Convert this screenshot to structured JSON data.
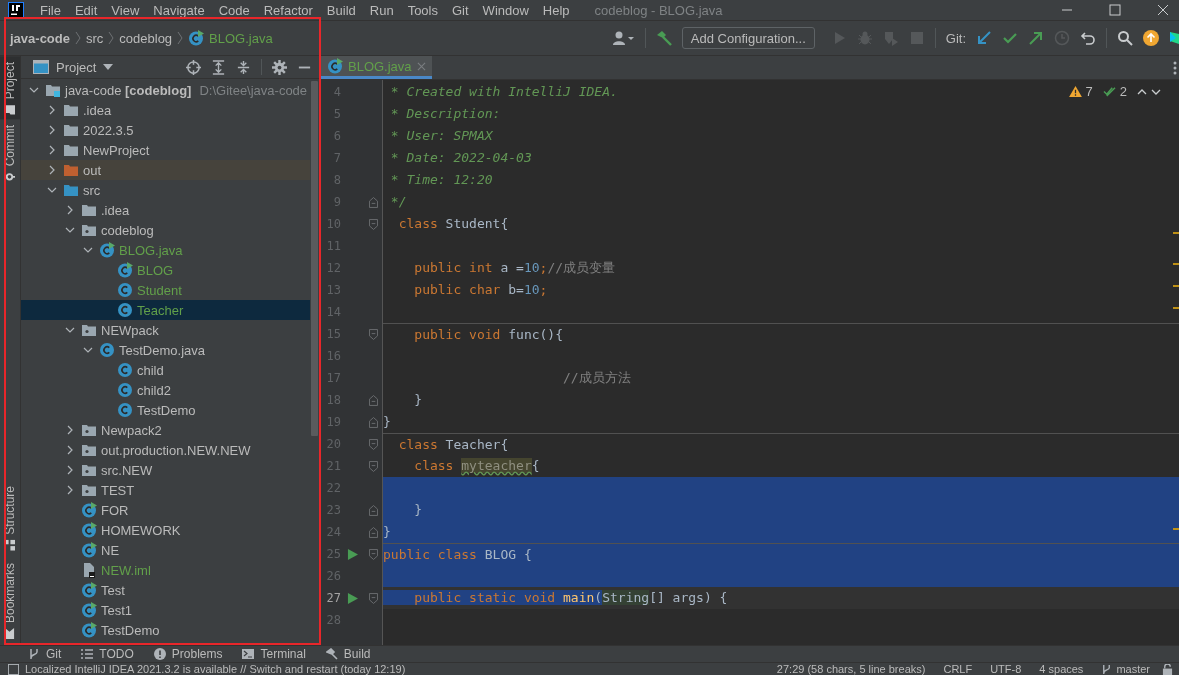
{
  "window": {
    "title": "codeblog - BLOG.java"
  },
  "menu": [
    "File",
    "Edit",
    "View",
    "Navigate",
    "Code",
    "Refactor",
    "Build",
    "Run",
    "Tools",
    "Git",
    "Window",
    "Help"
  ],
  "breadcrumbs": [
    "java-code",
    "src",
    "codeblog",
    "BLOG.java"
  ],
  "toolbar": {
    "config_button": "Add Configuration...",
    "git_label": "Git:",
    "actions": [
      {
        "kind": "run",
        "disabled": true
      },
      {
        "kind": "debug",
        "disabled": true
      },
      {
        "kind": "coverage",
        "disabled": true
      },
      {
        "kind": "stop",
        "disabled": true
      }
    ],
    "git_actions": [
      {
        "kind": "update",
        "disabled": false
      },
      {
        "kind": "commit",
        "disabled": false
      },
      {
        "kind": "push",
        "disabled": false
      },
      {
        "kind": "history",
        "disabled": true
      },
      {
        "kind": "rollback",
        "disabled": false
      }
    ]
  },
  "side_tabs": [
    {
      "label": "Project",
      "selected": true
    },
    {
      "label": "Commit",
      "selected": false
    },
    {
      "label": "Structure",
      "selected": false
    },
    {
      "label": "Bookmarks",
      "selected": false
    }
  ],
  "project": {
    "title": "Project",
    "tree": [
      {
        "label": "java-code **[codeblog]**",
        "path": "D:\\Gitee\\java-code",
        "kind": "module",
        "added": false,
        "selected": false,
        "expanded": true,
        "children": [
          {
            "label": ".idea",
            "kind": "folder",
            "added": false,
            "selected": false,
            "expanded": false
          },
          {
            "label": "2022.3.5",
            "kind": "folder",
            "added": false,
            "selected": false,
            "expanded": false
          },
          {
            "label": "NewProject",
            "kind": "folder",
            "added": false,
            "selected": false,
            "expanded": false
          },
          {
            "label": "out",
            "kind": "excluded-folder",
            "added": false,
            "selected": false,
            "expanded": false
          },
          {
            "label": "src",
            "kind": "source-folder",
            "added": false,
            "selected": false,
            "expanded": true,
            "children": [
              {
                "label": ".idea",
                "kind": "folder",
                "added": false,
                "selected": false,
                "expanded": false
              },
              {
                "label": "codeblog",
                "kind": "package",
                "added": false,
                "selected": false,
                "expanded": true,
                "children": [
                  {
                    "label": "BLOG.java",
                    "kind": "runnable-java-file",
                    "added": true,
                    "selected": false,
                    "expanded": true,
                    "children": [
                      {
                        "label": "BLOG",
                        "kind": "runnable-class",
                        "added": true,
                        "selected": false
                      },
                      {
                        "label": "Student",
                        "kind": "class",
                        "added": true,
                        "selected": false
                      },
                      {
                        "label": "Teacher",
                        "kind": "class",
                        "added": true,
                        "selected": true
                      }
                    ]
                  }
                ]
              },
              {
                "label": "NEWpack",
                "kind": "package",
                "added": false,
                "selected": false,
                "expanded": true,
                "children": [
                  {
                    "label": "TestDemo.java",
                    "kind": "java-file",
                    "added": false,
                    "selected": false,
                    "expanded": true,
                    "children": [
                      {
                        "label": "child",
                        "kind": "class",
                        "added": false,
                        "selected": false
                      },
                      {
                        "label": "child2",
                        "kind": "class",
                        "added": false,
                        "selected": false
                      },
                      {
                        "label": "TestDemo",
                        "kind": "class",
                        "added": false,
                        "selected": false
                      }
                    ]
                  }
                ]
              },
              {
                "label": "Newpack2",
                "kind": "package",
                "added": false,
                "selected": false,
                "expanded": false
              },
              {
                "label": "out.production.NEW.NEW",
                "kind": "package",
                "added": false,
                "selected": false,
                "expanded": false
              },
              {
                "label": "src.NEW",
                "kind": "package",
                "added": false,
                "selected": false,
                "expanded": false
              },
              {
                "label": "TEST",
                "kind": "package",
                "added": false,
                "selected": false,
                "expanded": false
              },
              {
                "label": "FOR",
                "kind": "runnable-class",
                "added": false,
                "selected": false
              },
              {
                "label": "HOMEWORK",
                "kind": "runnable-class",
                "added": false,
                "selected": false
              },
              {
                "label": "NE",
                "kind": "runnable-class",
                "added": false,
                "selected": false
              },
              {
                "label": "NEW.iml",
                "kind": "module-file",
                "added": true,
                "selected": false
              },
              {
                "label": "Test",
                "kind": "runnable-class",
                "added": false,
                "selected": false
              },
              {
                "label": "Test1",
                "kind": "runnable-class",
                "added": false,
                "selected": false
              },
              {
                "label": "TestDemo",
                "kind": "runnable-class",
                "added": false,
                "selected": false
              }
            ]
          }
        ]
      }
    ]
  },
  "editor": {
    "tabs": [
      {
        "label": "BLOG.java",
        "selected": true
      }
    ],
    "inspections": {
      "warnings": "7",
      "passed": "2"
    },
    "lines": [
      {
        "number": "4",
        "tokens": [
          {
            "kind": "doc",
            "text": " * Created with IntelliJ IDEA."
          }
        ]
      },
      {
        "number": "5",
        "tokens": [
          {
            "kind": "doc",
            "text": " * Description:"
          }
        ]
      },
      {
        "number": "6",
        "tokens": [
          {
            "kind": "doc",
            "text": " * User: SPMAX"
          }
        ]
      },
      {
        "number": "7",
        "tokens": [
          {
            "kind": "doc",
            "text": " * Date: 2022-04-03"
          }
        ]
      },
      {
        "number": "8",
        "tokens": [
          {
            "kind": "doc",
            "text": " * Time: 12:20"
          }
        ]
      },
      {
        "number": "9",
        "fold_end": true,
        "tokens": [
          {
            "kind": "doc",
            "text": " */"
          }
        ]
      },
      {
        "number": "10",
        "fold_start": true,
        "tokens": [
          {
            "kind": "keyword",
            "text": "  class"
          },
          {
            "kind": "plain",
            "text": " Student{"
          }
        ]
      },
      {
        "number": "11"
      },
      {
        "number": "12",
        "tokens": [
          {
            "kind": "keyword",
            "text": "    public int"
          },
          {
            "kind": "plain",
            "text": " a ="
          },
          {
            "kind": "number",
            "text": "10"
          },
          {
            "kind": "keyword",
            "text": ";"
          },
          {
            "kind": "comment",
            "text": "//成员变量"
          }
        ]
      },
      {
        "number": "13",
        "tokens": [
          {
            "kind": "keyword",
            "text": "    public char"
          },
          {
            "kind": "plain",
            "text": " b="
          },
          {
            "kind": "number",
            "text": "10"
          },
          {
            "kind": "keyword",
            "text": ";"
          }
        ]
      },
      {
        "number": "14"
      },
      {
        "number": "15",
        "fold_start": true,
        "separator": true,
        "tokens": [
          {
            "kind": "keyword",
            "text": "    public void"
          },
          {
            "kind": "plain",
            "text": " func(){"
          }
        ]
      },
      {
        "number": "16"
      },
      {
        "number": "17",
        "tokens": [
          {
            "kind": "comment",
            "text": "                       //成员方法"
          }
        ]
      },
      {
        "number": "18",
        "fold_end": true,
        "tokens": [
          {
            "kind": "plain",
            "text": "    }"
          }
        ]
      },
      {
        "number": "19",
        "fold_end": true,
        "tokens": [
          {
            "kind": "plain",
            "text": "}"
          }
        ]
      },
      {
        "number": "20",
        "fold_start": true,
        "separator": true,
        "tokens": [
          {
            "kind": "keyword",
            "text": "  class"
          },
          {
            "kind": "plain",
            "text": " Teacher{"
          }
        ]
      },
      {
        "number": "21",
        "fold_start": true,
        "tokens": [
          {
            "kind": "keyword",
            "text": "    class "
          },
          {
            "kind": "unused",
            "text": "myteacher"
          },
          {
            "kind": "plain",
            "text": "{"
          }
        ]
      },
      {
        "number": "22",
        "selected": true
      },
      {
        "number": "23",
        "fold_end": true,
        "selected": true,
        "tokens": [
          {
            "kind": "plain",
            "text": "    }"
          }
        ]
      },
      {
        "number": "24",
        "fold_end": true,
        "selected": true,
        "tokens": [
          {
            "kind": "plain",
            "text": "}"
          }
        ]
      },
      {
        "number": "25",
        "run": true,
        "fold_start": true,
        "separator": true,
        "selected": true,
        "tokens": [
          {
            "kind": "keyword",
            "text": "public class"
          },
          {
            "kind": "plain",
            "text": " BLOG {"
          }
        ]
      },
      {
        "number": "26",
        "selected": true
      },
      {
        "number": "27",
        "current": true,
        "run": true,
        "fold_start": true,
        "tokens": [
          {
            "kind": "keyword",
            "text": "    public static void ",
            "selected": true
          },
          {
            "kind": "method",
            "text": "main",
            "selected": true
          },
          {
            "kind": "plain",
            "text": "(",
            "selected": true
          },
          {
            "kind": "highlighted",
            "text": "String",
            "selected": false
          },
          {
            "kind": "plain",
            "text": "[] args) {",
            "selected": false
          }
        ]
      },
      {
        "number": "28"
      }
    ]
  },
  "bottom_tabs": [
    {
      "kind": "git",
      "label": "Git"
    },
    {
      "kind": "todo",
      "label": "TODO"
    },
    {
      "kind": "problems",
      "label": "Problems"
    },
    {
      "kind": "terminal",
      "label": "Terminal"
    },
    {
      "kind": "build",
      "label": "Build"
    }
  ],
  "status_bar": {
    "message": "Localized IntelliJ IDEA 2021.3.2 is available // Switch and restart (today 12:19)",
    "position": "27:29 (58 chars, 5 line breaks)",
    "line_separator": "CRLF",
    "encoding": "UTF-8",
    "indent": "4 spaces",
    "branch": "master"
  }
}
